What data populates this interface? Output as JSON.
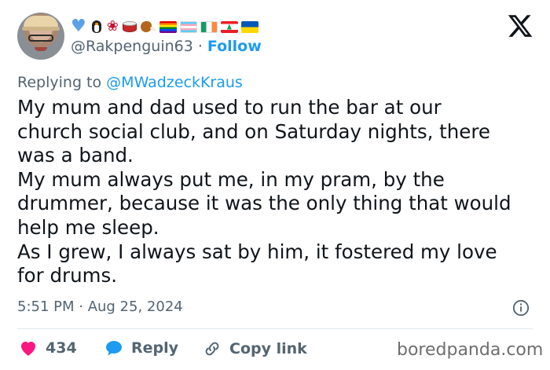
{
  "tweet": {
    "author": {
      "handle": "@Rakpenguin63",
      "follow_label": "Follow",
      "separator": "·",
      "name_emojis": [
        "blue-heart",
        "penguin",
        "rose",
        "drum",
        "poultry-leg",
        "rainbow-flag",
        "transgender-flag",
        "ireland-flag",
        "lebanon-flag",
        "ukraine-flag"
      ]
    },
    "replying_prefix": "Replying to",
    "replying_to": "@MWadzeckKraus",
    "body_lines": [
      "My mum and dad used to run the bar at our",
      "church social club, and on Saturday nights, there",
      "was a band.",
      "My mum always put me, in my pram, by the",
      "drummer, because it was the only thing that would",
      "help me sleep.",
      "As I grew, I always sat by him, it fostered my love",
      "for drums."
    ],
    "timestamp": "5:51 PM · Aug 25, 2024",
    "actions": {
      "likes_count": "434",
      "reply_label": "Reply",
      "copy_label": "Copy link"
    }
  },
  "watermark": "boredpanda.com",
  "colors": {
    "accent": "#1d9bf0",
    "like": "#f91880",
    "secondary_text": "#536471",
    "text": "#0f1419"
  }
}
